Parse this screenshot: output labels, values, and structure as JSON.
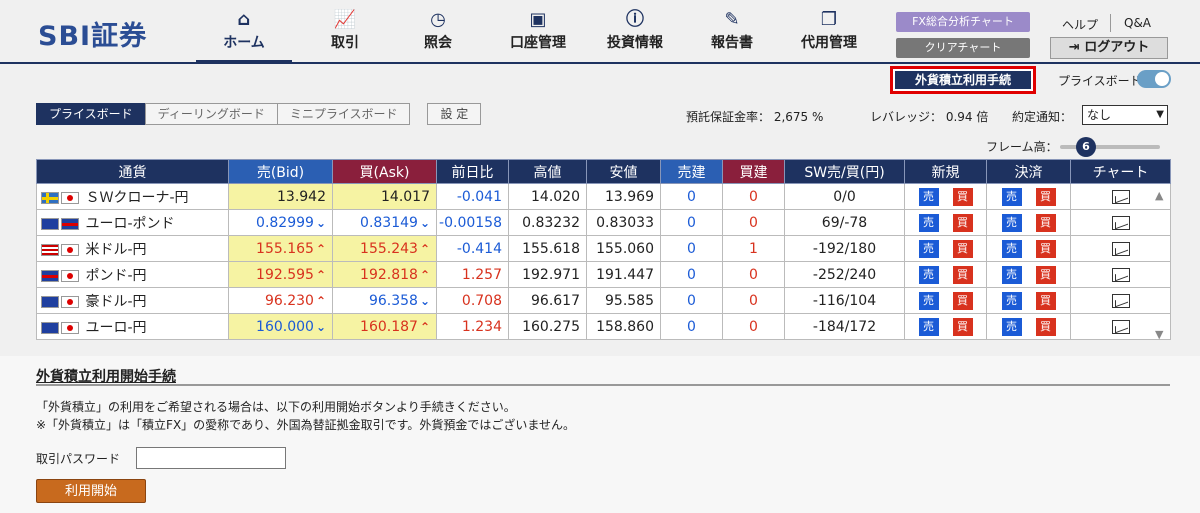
{
  "header": {
    "logo": "SBI証券",
    "nav": [
      {
        "label": "ホーム",
        "icon": "home-icon"
      },
      {
        "label": "取引",
        "icon": "trade-chart-icon"
      },
      {
        "label": "照会",
        "icon": "inquiry-icon"
      },
      {
        "label": "口座管理",
        "icon": "account-icon"
      },
      {
        "label": "投資情報",
        "icon": "info-icon"
      },
      {
        "label": "報告書",
        "icon": "report-icon"
      },
      {
        "label": "代用管理",
        "icon": "window-icon"
      }
    ],
    "fx_chart_button": "FX総合分析チャート",
    "clear_chart_button": "クリアチャート",
    "help": "ヘルプ",
    "qa": "Q&A",
    "logout": "ログアウト"
  },
  "fx_tsumitate_button": "外貨積立利用手続",
  "priceboard_toggle_label": "プライスボード",
  "tabs": [
    "プライスボード",
    "ディーリングボード",
    "ミニプライスボード",
    "設 定"
  ],
  "margin_rate": "預託保証金率： 2,675 %",
  "leverage": "レバレッジ： 0.94 倍",
  "notify_label": "約定通知：",
  "notify_value": "なし",
  "frame_label": "フレーム高：",
  "frame_value": "6",
  "table": {
    "headers": [
      "通貨",
      "売(Bid)",
      "買(Ask)",
      "前日比",
      "高値",
      "安値",
      "売建",
      "買建",
      "SW売/買(円)",
      "新規",
      "決済",
      "チャート"
    ],
    "sell_label": "売",
    "buy_label": "買",
    "rows": [
      {
        "pair": "ＳＷクローナ-円",
        "f1": "se",
        "f2": "jp",
        "bid": "13.942",
        "ask": "14.017",
        "change": "-0.041",
        "high": "14.020",
        "low": "13.969",
        "short": "0",
        "long": "0",
        "sw": "0/0",
        "bid_dir": "",
        "ask_dir": "",
        "bid_hl": true,
        "ask_hl": true
      },
      {
        "pair": "ユーロ-ポンド",
        "f1": "eu",
        "f2": "gb",
        "bid": "0.82999",
        "ask": "0.83149",
        "change": "-0.00158",
        "high": "0.83232",
        "low": "0.83033",
        "short": "0",
        "long": "0",
        "sw": "69/-78",
        "bid_dir": "down",
        "ask_dir": "down",
        "bid_hl": false,
        "ask_hl": false
      },
      {
        "pair": "米ドル-円",
        "f1": "us",
        "f2": "jp",
        "bid": "155.165",
        "ask": "155.243",
        "change": "-0.414",
        "high": "155.618",
        "low": "155.060",
        "short": "0",
        "long": "1",
        "sw": "-192/180",
        "bid_dir": "up",
        "ask_dir": "up",
        "bid_hl": true,
        "ask_hl": true
      },
      {
        "pair": "ポンド-円",
        "f1": "gb",
        "f2": "jp",
        "bid": "192.595",
        "ask": "192.818",
        "change": "1.257",
        "high": "192.971",
        "low": "191.447",
        "short": "0",
        "long": "0",
        "sw": "-252/240",
        "bid_dir": "up",
        "ask_dir": "up",
        "bid_hl": true,
        "ask_hl": true
      },
      {
        "pair": "豪ドル-円",
        "f1": "au",
        "f2": "jp",
        "bid": "96.230",
        "ask": "96.358",
        "change": "0.708",
        "high": "96.617",
        "low": "95.585",
        "short": "0",
        "long": "0",
        "sw": "-116/104",
        "bid_dir": "up",
        "ask_dir": "down",
        "bid_hl": false,
        "ask_hl": false
      },
      {
        "pair": "ユーロ-円",
        "f1": "eu",
        "f2": "jp",
        "bid": "160.000",
        "ask": "160.187",
        "change": "1.234",
        "high": "160.275",
        "low": "158.860",
        "short": "0",
        "long": "0",
        "sw": "-184/172",
        "bid_dir": "down",
        "ask_dir": "up",
        "bid_hl": true,
        "ask_hl": true
      }
    ]
  },
  "section": {
    "title": "外貨積立利用開始手続",
    "desc1": "「外貨積立」の利用をご希望される場合は、以下の利用開始ボタンより手続きください。",
    "desc2": "※「外貨積立」は「積立FX」の愛称であり、外国為替証拠金取引です。外貨預金ではございません。",
    "password_label": "取引パスワード",
    "start_button": "利用開始"
  },
  "colors": {
    "navy": "#1e3260",
    "bid_header": "#2b5fb3",
    "ask_header": "#8a1f3c",
    "highlight": "#f6f3a3",
    "up": "#d8321e",
    "down": "#1b5bd6"
  }
}
